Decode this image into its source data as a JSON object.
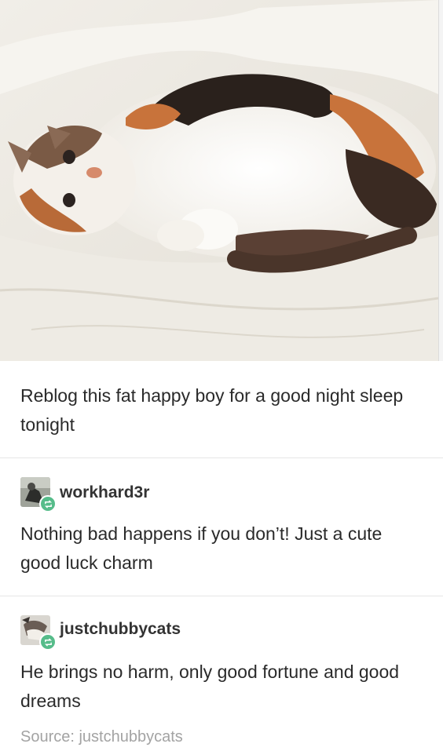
{
  "post": {
    "photo": {
      "subject": "calico-cat"
    },
    "caption": "Reblog this fat happy boy for a good night sleep tonight"
  },
  "reblogs": [
    {
      "username": "workhard3r",
      "text": "Nothing bad happens if you don’t! Just a cute good luck charm"
    },
    {
      "username": "justchubbycats",
      "text": "He brings no harm, only good fortune and good dreams"
    }
  ],
  "source": "Source: justchubbycats",
  "colors": {
    "reblog_badge": "#56bc8a",
    "source_text": "#a3a3a3",
    "body_text": "#2a2a2a"
  },
  "icons": {
    "reblog_badge": "reblog-icon"
  }
}
